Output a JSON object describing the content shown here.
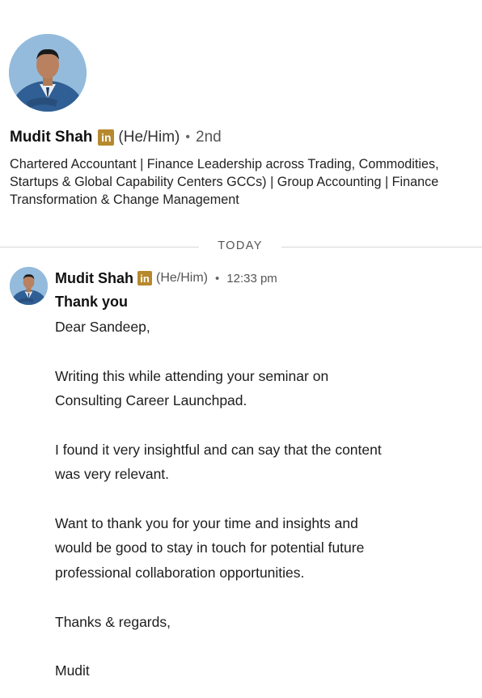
{
  "profile": {
    "name": "Mudit Shah",
    "badge": "in",
    "pronouns": "(He/Him)",
    "separator": "•",
    "degree": "2nd",
    "headline": "Chartered Accountant | Finance Leadership across Trading, Commodities, Startups & Global Capability Centers GCCs) | Group Accounting | Finance Transformation & Change Management"
  },
  "divider": {
    "label": "TODAY"
  },
  "message": {
    "sender": "Mudit Shah",
    "badge": "in",
    "pronouns": "(He/Him)",
    "separator": "•",
    "time": "12:33 pm",
    "subject": "Thank you",
    "lines": [
      "Dear Sandeep,",
      "Writing this while attending your seminar on",
      "Consulting Career Launchpad.",
      "I found it very insightful and can say that the content",
      "was very relevant.",
      "Want to thank you for your time and insights and",
      "would be good to stay in touch for potential future",
      "professional collaboration opportunities.",
      "Thanks & regards,",
      "Mudit"
    ]
  },
  "colors": {
    "badge": "#b7892d",
    "avatar_bg": "#8fb6d8",
    "suit": "#2f5f94"
  }
}
